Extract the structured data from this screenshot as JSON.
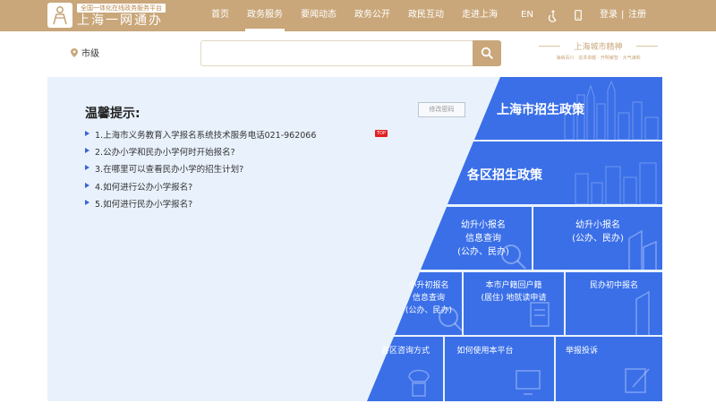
{
  "header": {
    "logo_tag": "全国一体化在线政务服务平台",
    "logo_name": "上海一网通办",
    "nav": [
      {
        "label": "首页",
        "active": false
      },
      {
        "label": "政务服务",
        "active": true
      },
      {
        "label": "要闻动态",
        "active": false
      },
      {
        "label": "政务公开",
        "active": false
      },
      {
        "label": "政民互动",
        "active": false
      },
      {
        "label": "走进上海",
        "active": false
      }
    ],
    "lang": "EN",
    "login": "登录",
    "separator": "|",
    "register": "注册"
  },
  "search": {
    "location": "市级",
    "placeholder": "",
    "value": ""
  },
  "brand": {
    "title": "上海城市精神",
    "subtitle": "海纳百川 · 追求卓越 · 开明睿智 · 大气谦和"
  },
  "tips": {
    "title": "温馨提示:",
    "change_password": "修改密码",
    "items": [
      "1.上海市义务教育入学报名系统技术服务电话021-962066",
      "2.公办小学和民办小学何时开始报名?",
      "3.在哪里可以查看民办小学的招生计划?",
      "4.如何进行公办小学报名?",
      "5.如何进行民办小学报名?"
    ],
    "top_badge": "TOP"
  },
  "tiles": {
    "city_policy": "上海市招生政策",
    "district_policy": "各区招生政策",
    "kg_to_primary": [
      "幼升小报名",
      "信息查询",
      "(公办、民办)"
    ],
    "kg_to_primary_reg": [
      "幼升小报名",
      "(公办、民办)"
    ],
    "primary_to_middle": [
      "小升初报名",
      "信息查询",
      "(公办、民办)"
    ],
    "hukou": [
      "本市户籍回户籍",
      "(居住) 地就读申请"
    ],
    "private_middle": "民办初中报名",
    "district_consult": "各区咨询方式",
    "how_to_use": "如何使用本平台",
    "report": "举报投诉"
  },
  "colors": {
    "header_gold": "#c9a77a",
    "tile_blue": "#3a6fe8",
    "tile_blue_dark": "#2f5fd6",
    "panel_bg": "#e9f2fc"
  }
}
